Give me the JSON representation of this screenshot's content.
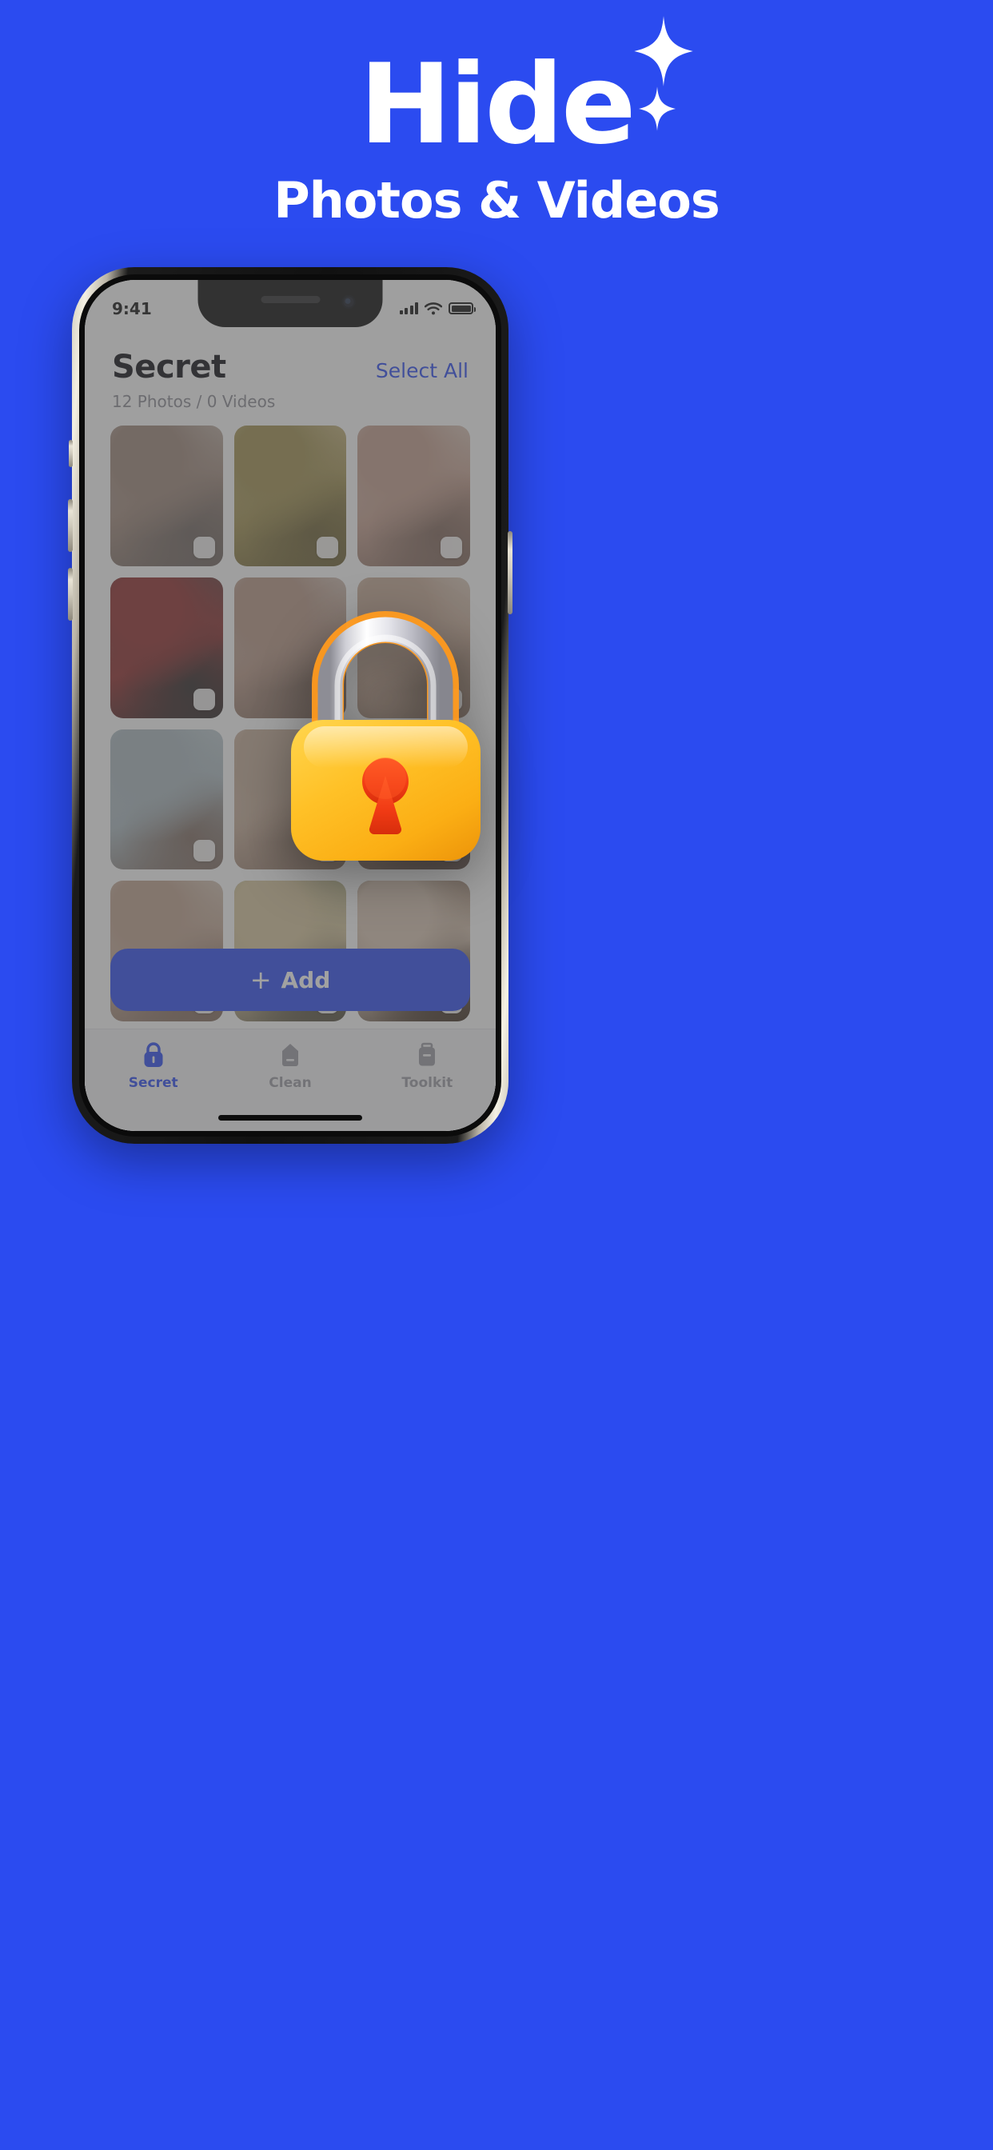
{
  "theme": {
    "background_blue": "#2B4BF0",
    "accent_blue": "#2B4BF0",
    "lock_body_yellow": "#FFC127",
    "lock_keyhole_red": "#F03A14",
    "lock_shackle_silver": "#D9D9DE"
  },
  "hero": {
    "title": "Hide",
    "subtitle": "Photos & Videos",
    "sparkle_large": "sparkle-icon",
    "sparkle_small": "sparkle-icon"
  },
  "phone": {
    "status_bar": {
      "time": "9:41",
      "cellular": "signal-bars-icon",
      "wifi": "wifi-icon",
      "battery": "battery-full-icon"
    },
    "home_indicator": "home-indicator"
  },
  "app": {
    "header": {
      "title": "Secret",
      "select_all": "Select All"
    },
    "count_label": "12 Photos / 0 Videos",
    "photos": [
      {
        "id": 1,
        "alt": "portrait-woman-hand-on-chin",
        "c1": "#cfc6bd",
        "c2": "#9c8578",
        "c3": "#6d625d"
      },
      {
        "id": 2,
        "alt": "portrait-woman-gold-background",
        "c1": "#d8c69b",
        "c2": "#9f8f4f",
        "c3": "#6b5f33"
      },
      {
        "id": 3,
        "alt": "portrait-woman-with-white-flowers",
        "c1": "#e4ddd4",
        "c2": "#c29c8c",
        "c3": "#7d6358"
      },
      {
        "id": 4,
        "alt": "portrait-woman-red-dress-dark",
        "c1": "#4a4140",
        "c2": "#8e2a2a",
        "c3": "#2a2424"
      },
      {
        "id": 5,
        "alt": "portrait-woman-hand-over-face",
        "c1": "#dcd6d0",
        "c2": "#b59483",
        "c3": "#7a6357"
      },
      {
        "id": 6,
        "alt": "portrait-woman-eyes-closed-white",
        "c1": "#e3ddd3",
        "c2": "#c4a692",
        "c3": "#8d7564"
      },
      {
        "id": 7,
        "alt": "portrait-woman-blue-background",
        "c1": "#c6d3d8",
        "c2": "#a8b6bd",
        "c3": "#7d6a60"
      },
      {
        "id": 8,
        "alt": "portrait-woman-soft-light",
        "c1": "#e0d8cd",
        "c2": "#c2a894",
        "c3": "#8a7161"
      },
      {
        "id": 9,
        "alt": "portrait-woman-dark-hair-profile",
        "c1": "#d5cdc6",
        "c2": "#9c7f70",
        "c3": "#5c4a43"
      },
      {
        "id": 10,
        "alt": "portrait-woman-resting-head-on-hand",
        "c1": "#ded7cb",
        "c2": "#bda08d",
        "c3": "#80695c"
      },
      {
        "id": 11,
        "alt": "portrait-woman-blonde-outdoors",
        "c1": "#9aa07a",
        "c2": "#d6c49b",
        "c3": "#4f4a3b"
      },
      {
        "id": 12,
        "alt": "portrait-woman-brown-background",
        "c1": "#6d5340",
        "c2": "#d8c4b2",
        "c3": "#3c2c20"
      }
    ],
    "checkbox_label": "photo-select-checkbox",
    "add_button": {
      "icon": "plus-icon",
      "label": "Add"
    },
    "tabs": [
      {
        "id": "secret",
        "label": "Secret",
        "icon": "lock-icon",
        "active": true
      },
      {
        "id": "clean",
        "label": "Clean",
        "icon": "broom-icon",
        "active": false
      },
      {
        "id": "toolkit",
        "label": "Toolkit",
        "icon": "toolbox-icon",
        "active": false
      }
    ]
  },
  "overlay": {
    "padlock_icon": "padlock-3d-icon"
  }
}
